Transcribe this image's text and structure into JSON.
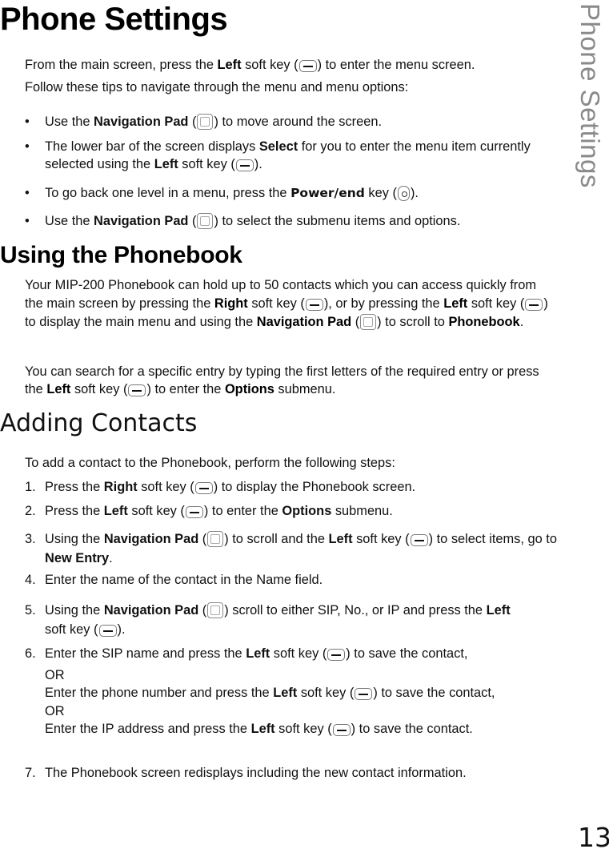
{
  "page": {
    "title": "Phone Settings",
    "side_tab": "Phone Settings",
    "page_number": "13"
  },
  "intro": {
    "line1": {
      "a": "From the main screen, press the ",
      "b": "Left",
      "c": " soft key (",
      "d": ") to enter the menu screen."
    },
    "line2": "Follow these tips to navigate through the menu and menu options:"
  },
  "tips": [
    {
      "a": "Use the ",
      "b": "Navigation Pad",
      "c": " (",
      "d": ") to move around the screen."
    },
    {
      "a": "The lower bar of the screen displays ",
      "b": "Select",
      "c": " for you to enter the menu item currently selected using the ",
      "d": "Left",
      "e": " soft key (",
      "f": ")."
    },
    {
      "a": "To go back one level in a menu, press the ",
      "b": "Power/end",
      "c": " key (",
      "d": ")."
    },
    {
      "a": "Use the ",
      "b": "Navigation Pad",
      "c": " (",
      "d": ") to select the submenu items and options."
    }
  ],
  "phonebook": {
    "heading": "Using the Phonebook",
    "para1": {
      "a": "Your MIP-200 Phonebook can hold up to 50 contacts which you can access quickly from the main screen by pressing the ",
      "b": "Right",
      "c": " soft key (",
      "d": "), or by pressing the ",
      "e": "Left",
      "f": " soft key (",
      "g": ") to display the main menu and using the ",
      "h": "Navigation Pad",
      "i": " (",
      "j": ") to scroll to ",
      "k": "Phonebook",
      "l": "."
    },
    "para2": {
      "a": "You can search for a specific entry by typing the first letters of the required entry or press the ",
      "b": "Left",
      "c": " soft key (",
      "d": ") to enter the ",
      "e": "Options",
      "f": " submenu."
    }
  },
  "adding": {
    "heading": "Adding Contacts",
    "intro": "To add a contact to the Phonebook, perform the following steps:",
    "steps": [
      {
        "num": "1.",
        "a": "Press the ",
        "b": "Right",
        "c": " soft key (",
        "d": ") to display the Phonebook screen."
      },
      {
        "num": "2.",
        "a": "Press the ",
        "b": "Left",
        "c": " soft key (",
        "d": ") to enter the ",
        "e": "Options",
        "f": " submenu."
      },
      {
        "num": "3.",
        "a": "Using the ",
        "b": "Navigation Pad",
        "c": " (",
        "d": ") to scroll and the ",
        "e": "Left",
        "f": " soft key (",
        "g": ") to select items, go to ",
        "h": "New Entry",
        "i": "."
      },
      {
        "num": "4.",
        "a": "Enter the name of the contact in the Name field."
      },
      {
        "num": "5.",
        "a": "Using the ",
        "b": "Navigation Pad",
        "c": " (",
        "d": ") scroll to either SIP, No., or IP and press the ",
        "e": "Left",
        "f": " soft key (",
        "g": ")."
      },
      {
        "num": "6.",
        "a": "Enter the SIP name and press the ",
        "b": "Left",
        "c": " soft key (",
        "d": ") to save the contact,",
        "or1": "OR",
        "e": "Enter the phone number and press the ",
        "f": "Left",
        "g": " soft key (",
        "h": ") to save the contact,",
        "or2": "OR",
        "i": "Enter the IP address and press the ",
        "j": "Left",
        "k": " soft key (",
        "l": ") to save the contact."
      },
      {
        "num": "7.",
        "a": "The Phonebook screen redisplays including the new contact information."
      }
    ]
  }
}
